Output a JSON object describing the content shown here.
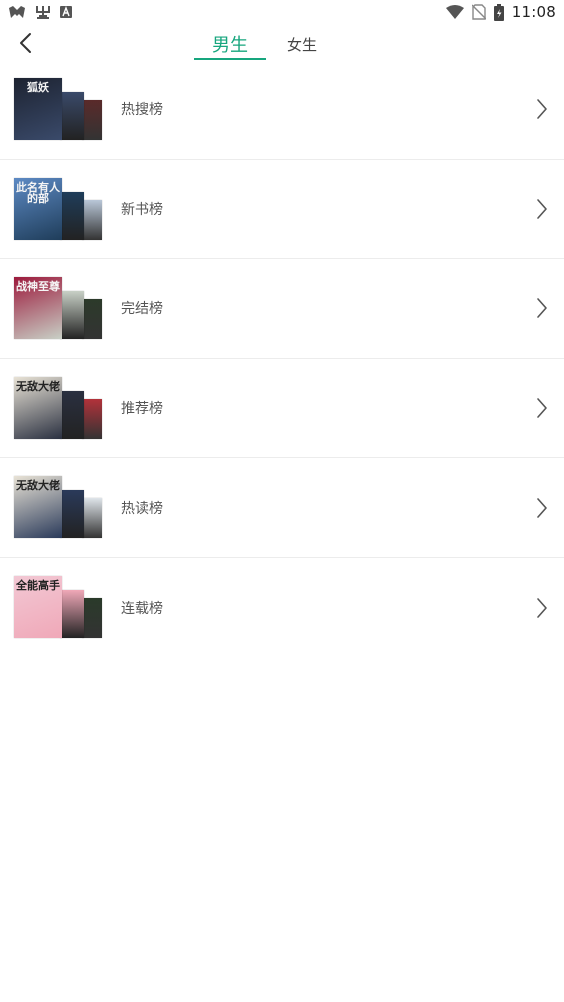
{
  "status_bar": {
    "time": "11:08",
    "left_icons": [
      "game-controller-icon",
      "bug-icon",
      "font-a-icon"
    ],
    "right_icons": [
      "wifi-icon",
      "no-sim-icon",
      "battery-icon"
    ]
  },
  "header": {
    "tabs": [
      {
        "label": "男生",
        "active": true
      },
      {
        "label": "女生",
        "active": false
      }
    ],
    "accent_color": "#17a67e"
  },
  "rank_list": [
    {
      "label": "热搜榜",
      "cover_text": "狐妖",
      "cover_colors": [
        "#1d2331",
        "#3a4a6a",
        "#5a2a2a"
      ]
    },
    {
      "label": "新书榜",
      "cover_text": "此名有人的部",
      "cover_colors": [
        "#5d8ac4",
        "#1f3d5a",
        "#b9c7d8"
      ]
    },
    {
      "label": "完结榜",
      "cover_text": "战神至尊",
      "cover_colors": [
        "#9c1a3c",
        "#c8d0c6",
        "#2c3a2a"
      ]
    },
    {
      "label": "推荐榜",
      "cover_text": "无敌大佬",
      "cover_colors": [
        "#e9e3d6",
        "#2a3040",
        "#b2323a"
      ]
    },
    {
      "label": "热读榜",
      "cover_text": "无敌大佬",
      "cover_colors": [
        "#e9e3d6",
        "#2a3a5a",
        "#dfe5ea"
      ]
    },
    {
      "label": "连载榜",
      "cover_text": "全能高手",
      "cover_colors": [
        "#f2c8d4",
        "#f0a8b8",
        "#2a3a2a"
      ]
    }
  ]
}
